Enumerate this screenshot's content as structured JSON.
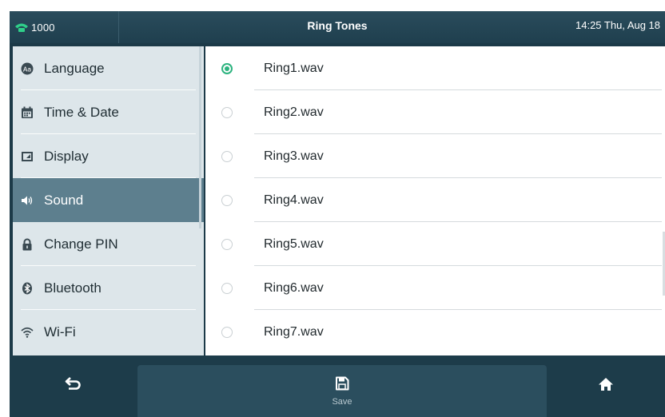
{
  "status_bar": {
    "line": "1000",
    "title": "Ring Tones",
    "clock": "14:25 Thu, Aug 18"
  },
  "sidebar": {
    "items": [
      {
        "label": "Language",
        "icon": "language-icon",
        "active": false
      },
      {
        "label": "Time & Date",
        "icon": "calendar-icon",
        "active": false
      },
      {
        "label": "Display",
        "icon": "display-icon",
        "active": false
      },
      {
        "label": "Sound",
        "icon": "speaker-icon",
        "active": true
      },
      {
        "label": "Change PIN",
        "icon": "lock-icon",
        "active": false
      },
      {
        "label": "Bluetooth",
        "icon": "bluetooth-icon",
        "active": false
      },
      {
        "label": "Wi-Fi",
        "icon": "wifi-icon",
        "active": false
      }
    ]
  },
  "ring_tones": {
    "selected": "Ring1.wav",
    "items": [
      "Ring1.wav",
      "Ring2.wav",
      "Ring3.wav",
      "Ring4.wav",
      "Ring5.wav",
      "Ring6.wav",
      "Ring7.wav"
    ]
  },
  "softkeys": {
    "back_icon": "back-arrow-icon",
    "save_label": "Save",
    "save_icon": "save-icon",
    "home_icon": "home-icon"
  },
  "colors": {
    "accent_green": "#2db37f",
    "active_item": "#5d7f8e",
    "bar_dark": "#1d3c4a"
  }
}
